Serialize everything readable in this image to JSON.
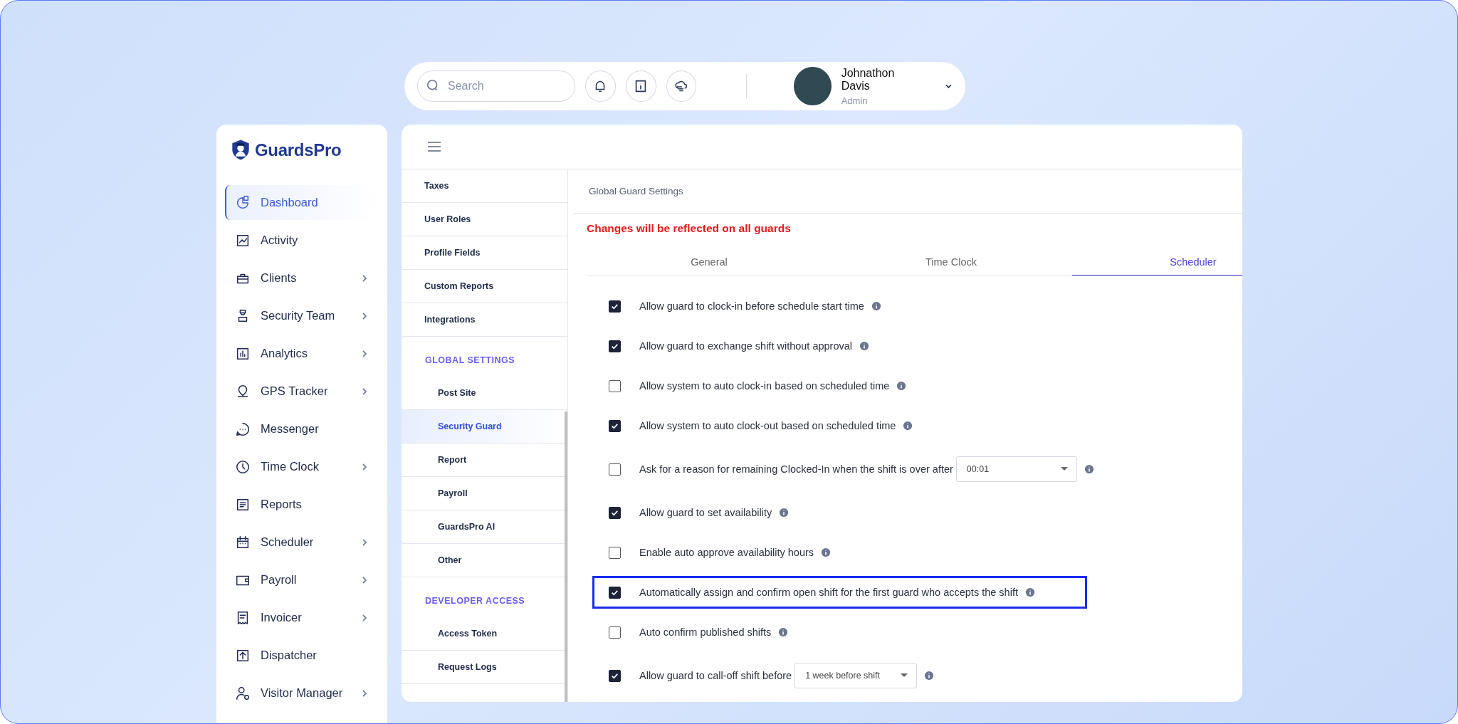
{
  "topbar": {
    "search": {
      "placeholder": "Search"
    },
    "user": {
      "name": "Johnathon Davis",
      "role": "Admin"
    }
  },
  "sidebar": {
    "logo": "GuardsPro",
    "items": [
      {
        "label": "Dashboard",
        "selected": true,
        "submenu": false
      },
      {
        "label": "Activity",
        "selected": false,
        "submenu": false
      },
      {
        "label": "Clients",
        "selected": false,
        "submenu": true
      },
      {
        "label": "Security Team",
        "selected": false,
        "submenu": true
      },
      {
        "label": "Analytics",
        "selected": false,
        "submenu": true
      },
      {
        "label": "GPS Tracker",
        "selected": false,
        "submenu": true
      },
      {
        "label": "Messenger",
        "selected": false,
        "submenu": false
      },
      {
        "label": "Time Clock",
        "selected": false,
        "submenu": true
      },
      {
        "label": "Reports",
        "selected": false,
        "submenu": false
      },
      {
        "label": "Scheduler",
        "selected": false,
        "submenu": true
      },
      {
        "label": "Payroll",
        "selected": false,
        "submenu": true
      },
      {
        "label": "Invoicer",
        "selected": false,
        "submenu": true
      },
      {
        "label": "Dispatcher",
        "selected": false,
        "submenu": false
      },
      {
        "label": "Visitor Manager",
        "selected": false,
        "submenu": true
      }
    ]
  },
  "settings_menu": {
    "items": [
      {
        "label": "Taxes",
        "selected": false
      },
      {
        "label": "User Roles",
        "selected": false
      },
      {
        "label": "Profile Fields",
        "selected": false
      },
      {
        "label": "Custom Reports",
        "selected": false
      },
      {
        "label": "Integrations",
        "selected": false
      }
    ],
    "groups": [
      {
        "heading": "GLOBAL SETTINGS",
        "items": [
          {
            "label": "Post Site",
            "selected": false
          },
          {
            "label": "Security Guard",
            "selected": true
          },
          {
            "label": "Report",
            "selected": false
          },
          {
            "label": "Payroll",
            "selected": false
          },
          {
            "label": "GuardsPro AI",
            "selected": false
          },
          {
            "label": "Other",
            "selected": false
          }
        ]
      },
      {
        "heading": "DEVELOPER ACCESS",
        "items": [
          {
            "label": "Access Token",
            "selected": false
          },
          {
            "label": "Request Logs",
            "selected": false
          }
        ]
      }
    ]
  },
  "content": {
    "title": "Global Guard Settings",
    "warning": "Changes will be reflected on all guards",
    "tabs": [
      {
        "label": "General",
        "selected": false
      },
      {
        "label": "Time Clock",
        "selected": false
      },
      {
        "label": "Scheduler",
        "selected": true
      }
    ],
    "settings": [
      {
        "kind": "checkbox",
        "label": "Allow guard to clock-in before schedule start time",
        "checked": true,
        "highlighted": false
      },
      {
        "kind": "checkbox",
        "label": "Allow guard to exchange shift without approval",
        "checked": true,
        "highlighted": false
      },
      {
        "kind": "checkbox",
        "label": "Allow system to auto clock-in based on scheduled time",
        "checked": false,
        "highlighted": false
      },
      {
        "kind": "checkbox",
        "label": "Allow system to auto clock-out based on scheduled time",
        "checked": true,
        "highlighted": false
      },
      {
        "kind": "select",
        "label": "Ask for a reason for remaining Clocked-In when the shift is over after",
        "checked": false,
        "highlighted": false,
        "value": "00:01"
      },
      {
        "kind": "checkbox",
        "label": "Allow guard to set availability",
        "checked": true,
        "highlighted": false
      },
      {
        "kind": "checkbox",
        "label": "Enable auto approve availability hours",
        "checked": false,
        "highlighted": false
      },
      {
        "kind": "checkbox",
        "label": "Automatically assign and confirm open shift for the first guard who accepts the shift",
        "checked": true,
        "highlighted": true
      },
      {
        "kind": "checkbox",
        "label": "Auto confirm published shifts",
        "checked": false,
        "highlighted": false
      },
      {
        "kind": "select",
        "label": "Allow guard to call-off shift before",
        "checked": true,
        "highlighted": false,
        "value": "1 week before shift"
      }
    ]
  }
}
